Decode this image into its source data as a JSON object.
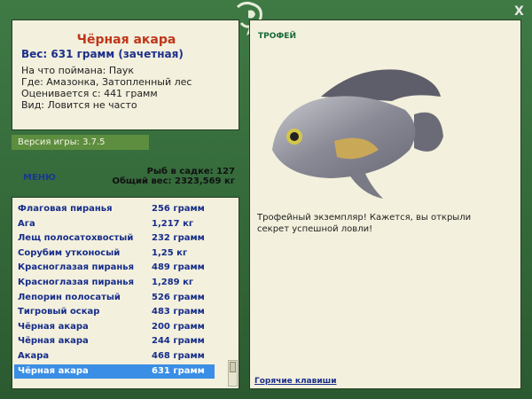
{
  "fish": {
    "name": "Чёрная акара",
    "weight_line": "Вес: 631 грамм (зачетная)",
    "details": [
      "На что поймана: Паук",
      "Где: Амазонка, Затопленный лес",
      "Оценивается с: 441 грамм",
      "Вид: Ловится не часто"
    ]
  },
  "version": "Версия игры: 3.7.5",
  "menu_label": "МЕНЮ",
  "stats": {
    "fish_in_net": "Рыб в садке: 127",
    "total_weight": "Общий вес: 2323,569 кг"
  },
  "catch_list": [
    {
      "name": "Флаговая пиранья",
      "weight": "256 грамм"
    },
    {
      "name": "Ага",
      "weight": "1,217 кг"
    },
    {
      "name": "Лещ полосатохвостый",
      "weight": "232 грамм"
    },
    {
      "name": "Сорубим утконосый",
      "weight": "1,25 кг"
    },
    {
      "name": "Красноглазая пиранья",
      "weight": "489 грамм"
    },
    {
      "name": "Красноглазая пиранья",
      "weight": "1,289 кг"
    },
    {
      "name": "Лепорин полосатый",
      "weight": "526 грамм"
    },
    {
      "name": "Тигровый оскар",
      "weight": "483 грамм"
    },
    {
      "name": "Чёрная акара",
      "weight": "200 грамм"
    },
    {
      "name": "Чёрная акара",
      "weight": "244 грамм"
    },
    {
      "name": "Акара",
      "weight": "468 грамм"
    },
    {
      "name": "Чёрная акара",
      "weight": "631 грамм"
    }
  ],
  "selected_index": 11,
  "trophy": {
    "label": "ТРОФЕЙ",
    "text": "Трофейный экземпляр! Кажется, вы открыли секрет успешной ловли!"
  },
  "hotkeys_label": "Горячие клавиши",
  "close_label": "X",
  "colors": {
    "frame": "#2f5f34",
    "panel": "#f3f0dd",
    "title": "#c0361b",
    "link": "#1c2f8a",
    "selection": "#3a8ee5",
    "version_bar": "#5d8e3f"
  },
  "icons": [
    "logo-fish-icon",
    "close-icon",
    "scroll-up-icon",
    "scroll-down-icon"
  ]
}
